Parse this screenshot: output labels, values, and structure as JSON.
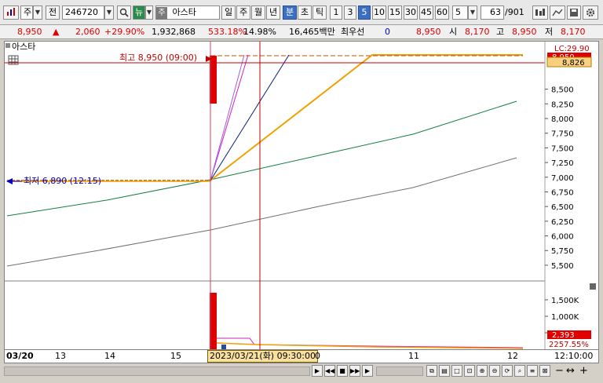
{
  "toolbar": {
    "period_type": "주",
    "market": "전",
    "code": "246720",
    "search_icon": "search-icon",
    "news_label": "뉴",
    "stock_prefix": "주",
    "stock_name": "아스타",
    "period_buttons": [
      "일",
      "주",
      "월",
      "년",
      "분",
      "초",
      "틱"
    ],
    "active_period": "분",
    "minute_buttons": [
      "1",
      "3",
      "5",
      "10",
      "15",
      "30",
      "45",
      "60"
    ],
    "active_minute": "5",
    "custom_minute": "5",
    "page_current": "63",
    "page_total": "/901",
    "tool_icons": [
      "grid-icon",
      "chart-type-icon",
      "save-icon",
      "settings-icon"
    ]
  },
  "infobar": {
    "price": "8,950",
    "change": "2,060",
    "change_pct": "+29.90%",
    "volume": "1,932,868",
    "volume_ratio": "533.18%",
    "turnover": "14.98%",
    "amount": "16,465백만",
    "ask_label": "최우선",
    "ask_value": "0",
    "bid_value": "8,950",
    "open_label": "시",
    "open_value": "8,170",
    "high_label": "고",
    "high_value": "8,950",
    "low_label": "저",
    "low_value": "8,170"
  },
  "chart": {
    "legend_name": "아스타",
    "high_annotation": "최고 8,950 (09:00)",
    "low_annotation": "최저 6,890 (12:15)",
    "limit_label": "LC:29.90",
    "current_price_tag": "8,950",
    "ma_tag": "8,826",
    "price_ticks": [
      "8,500",
      "8,250",
      "8,000",
      "7,750",
      "7,500",
      "7,250",
      "7,000",
      "6,750",
      "6,500",
      "6,250",
      "6,000",
      "5,750",
      "5,500"
    ],
    "volume_ticks": [
      "1,500K",
      "1,000K",
      "500,000"
    ],
    "volume_tag": "2,393",
    "volume_pct_tag": "2257.55%",
    "colors": {
      "candle_up": "#e00000",
      "ma_orange": "#f0a000",
      "ma_green": "#108040",
      "ma_gray": "#707070",
      "ma_magenta": "#d020c0",
      "ma_navy": "#102080",
      "crosshair": "#c00000"
    }
  },
  "chart_data": {
    "type": "line",
    "title": "아스타",
    "x": [
      "03/20 09:00",
      "03/20 15:30",
      "03/21 09:00",
      "03/21 12:15"
    ],
    "series": [
      {
        "values": [
          6300,
          6890,
          7120,
          8200
        ]
      },
      {
        "values": [
          5470,
          6050,
          6300,
          7280
        ]
      },
      {
        "values": [
          6890,
          6890,
          8950,
          8950
        ]
      }
    ],
    "ylim": [
      5300,
      8950
    ],
    "grid": false
  },
  "bottom_axis": {
    "labels": [
      "03/20",
      "13",
      "14",
      "15",
      "0",
      "11",
      "12"
    ],
    "cursor_time": "2023/03/21(화) 09:30:00",
    "right_time": "12:10:00",
    "zoom_minus": "−",
    "zoom_plus": "+"
  }
}
